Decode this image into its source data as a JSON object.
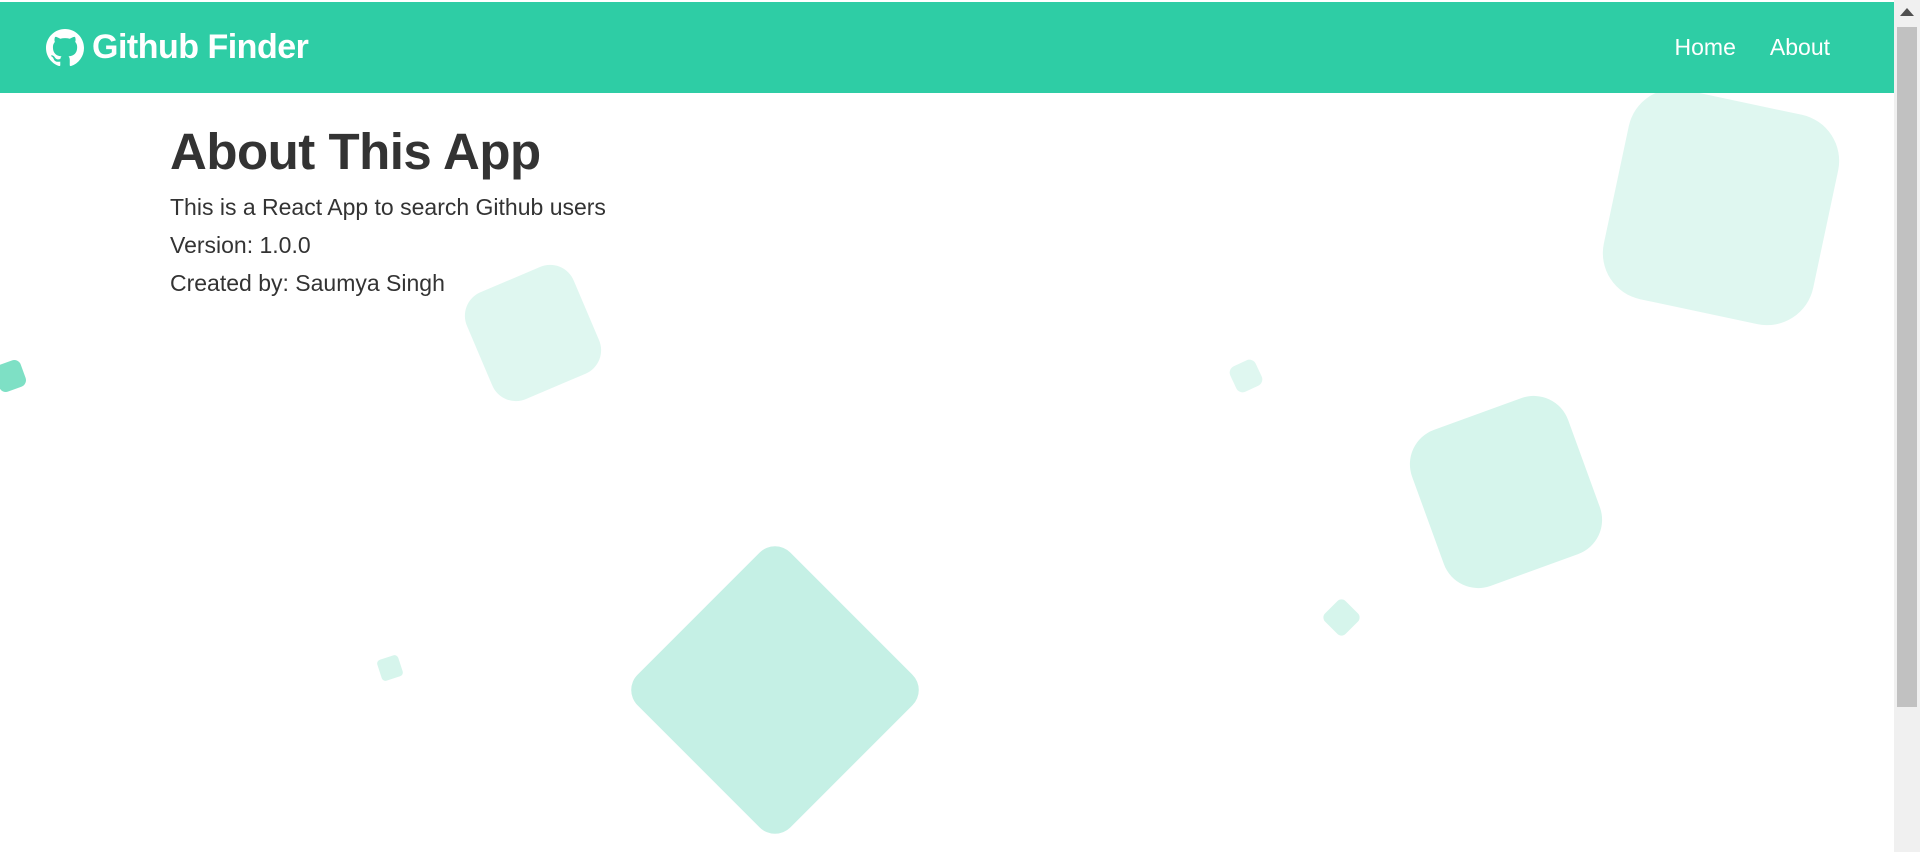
{
  "navbar": {
    "brand_icon": "github-icon",
    "brand_title": "Github Finder",
    "links": [
      {
        "label": "Home"
      },
      {
        "label": "About"
      }
    ],
    "color": "#2ecda5"
  },
  "about": {
    "heading": "About This App",
    "description": "This is a React App to search Github users",
    "version": "Version: 1.0.0",
    "author": "Created by: Saumya Singh"
  },
  "theme": {
    "accent": "#2ecda5",
    "text": "#333333",
    "shape_light": "#dff7f0",
    "shape_mid": "#c5f0e5",
    "shape_dark": "#7ee0c5"
  }
}
